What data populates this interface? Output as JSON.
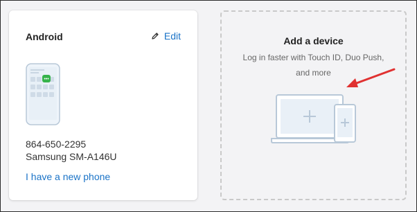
{
  "device_card": {
    "title": "Android",
    "edit_label": "Edit",
    "phone_number": "864-650-2295",
    "phone_model": "Samsung SM-A146U",
    "new_phone_link": "I have a new phone",
    "phone_badge": "•••"
  },
  "add_device_card": {
    "title": "Add a device",
    "subtitle": "Log in faster with Touch ID, Duo Push, and more"
  },
  "icons": {
    "edit": "pencil-icon",
    "phone": "phone-illustration",
    "devices": "laptop-and-phone-illustration",
    "arrow": "red-arrow-annotation"
  },
  "colors": {
    "link": "#1a73c7",
    "annotation_arrow": "#e03131",
    "phone_badge": "#35b34a",
    "illustration": "#b8c8d8"
  }
}
